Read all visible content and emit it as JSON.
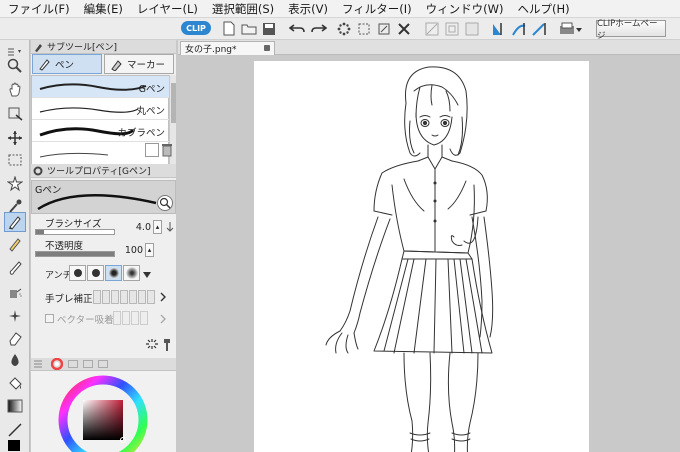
{
  "menubar": {
    "items": [
      {
        "label": "ファイル(F)"
      },
      {
        "label": "編集(E)"
      },
      {
        "label": "レイヤー(L)"
      },
      {
        "label": "選択範囲(S)"
      },
      {
        "label": "表示(V)"
      },
      {
        "label": "フィルター(I)"
      },
      {
        "label": "ウィンドウ(W)"
      },
      {
        "label": "ヘルプ(H)"
      }
    ]
  },
  "toolbar": {
    "badge_label": "CLIP",
    "clip_home_label": "CLIPホームページ"
  },
  "subtool_panel": {
    "title": "サブツール[ペン]",
    "tabs": [
      {
        "label": "ペン",
        "selected": true
      },
      {
        "label": "マーカー",
        "selected": false
      }
    ],
    "brushes": [
      {
        "label": "Gペン",
        "selected": true
      },
      {
        "label": "丸ペン",
        "selected": false
      },
      {
        "label": "カブラペン",
        "selected": false
      }
    ]
  },
  "tool_property": {
    "title": "ツールプロパティ[Gペン]",
    "preview_name": "Gペン",
    "brush_size_label": "ブラシサイズ",
    "brush_size_value": "4.0",
    "opacity_label": "不透明度",
    "opacity_value": "100",
    "opacity_fraction": 1.0,
    "antialias_label": "アンチ",
    "stabilization_label": "手ブレ補正",
    "vector_snap_label": "ベクター吸着"
  },
  "document": {
    "tab_title": "女の子.png*"
  },
  "colors": {
    "accent": "#2d86d0",
    "selection": "#cfe0f3",
    "canvas_bg": "#c9c9c9",
    "paper": "#ffffff"
  }
}
